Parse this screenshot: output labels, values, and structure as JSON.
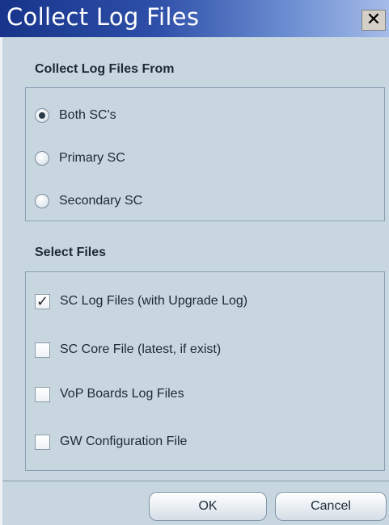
{
  "window": {
    "title": "Collect Log Files",
    "close_label": "✕"
  },
  "collect_from": {
    "heading": "Collect Log Files From",
    "options": [
      {
        "label": "Both SC's",
        "checked": true
      },
      {
        "label": "Primary SC",
        "checked": false
      },
      {
        "label": "Secondary SC",
        "checked": false
      }
    ]
  },
  "select_files": {
    "heading": "Select Files",
    "options": [
      {
        "label": "SC Log Files (with Upgrade Log)",
        "checked": true,
        "mark": "✓"
      },
      {
        "label": "SC Core File (latest, if exist)",
        "checked": false
      },
      {
        "label": "VoP Boards Log Files",
        "checked": false
      },
      {
        "label": "GW Configuration File",
        "checked": false
      }
    ]
  },
  "buttons": {
    "ok": "OK",
    "cancel": "Cancel"
  }
}
